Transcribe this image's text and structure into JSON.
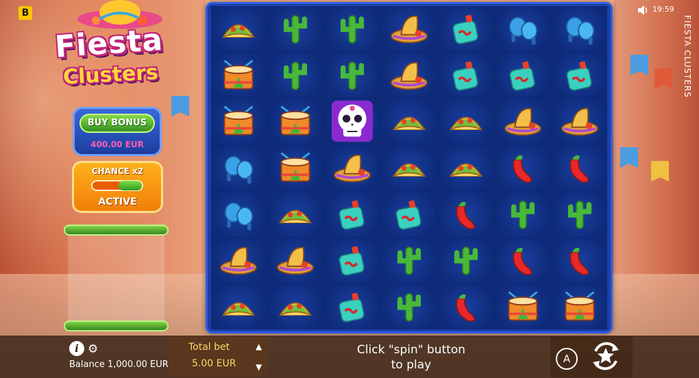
{
  "brand_badge": "B",
  "logo": {
    "line1": "Fiesta",
    "line2": "Clusters"
  },
  "buy_bonus": {
    "label": "BUY BONUS",
    "price": "400.00 EUR"
  },
  "chance": {
    "label": "CHANCE x2",
    "state": "ACTIVE"
  },
  "status": {
    "time": "19:59",
    "vertical_title": "FIESTA CLUSTERS"
  },
  "bottom": {
    "balance": "Balance 1,000.00 EUR",
    "total_bet_label": "Total bet",
    "total_bet_value": "5.00 EUR",
    "message_line1": "Click \"spin\" button",
    "message_line2": "to play",
    "auto_label": "A"
  },
  "grid": [
    [
      "taco",
      "cactus",
      "cactus",
      "sombrero",
      "bottle",
      "maracas",
      "maracas"
    ],
    [
      "drum",
      "cactus",
      "cactus",
      "sombrero",
      "bottle",
      "bottle",
      "bottle"
    ],
    [
      "drum",
      "drum",
      "skull",
      "taco",
      "taco",
      "sombrero",
      "sombrero"
    ],
    [
      "maracas",
      "drum",
      "sombrero",
      "taco",
      "taco",
      "chili",
      "chili"
    ],
    [
      "maracas",
      "taco",
      "bottle",
      "bottle",
      "chili",
      "cactus",
      "cactus"
    ],
    [
      "sombrero",
      "sombrero",
      "bottle",
      "cactus",
      "cactus",
      "chili",
      "chili"
    ],
    [
      "taco",
      "taco",
      "bottle",
      "cactus",
      "chili",
      "drum",
      "drum"
    ]
  ],
  "colors": {
    "board": "#1c3fa8",
    "accent_green": "#2d8a1e",
    "accent_orange": "#f07d0a"
  }
}
